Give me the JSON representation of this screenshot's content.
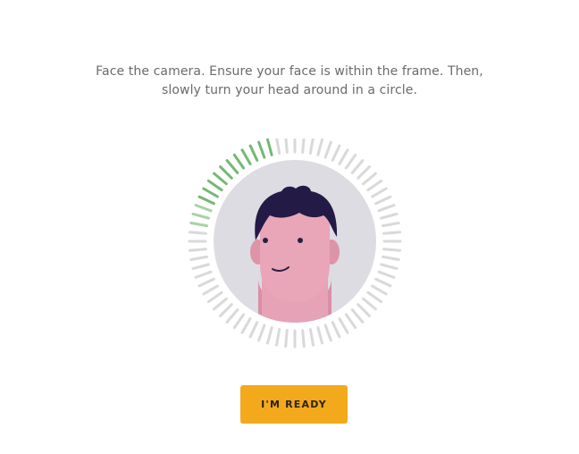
{
  "instructions": {
    "line1": "Face the camera. Ensure your face is within the frame. Then,",
    "line2": "slowly turn your head around in a circle."
  },
  "scan_progress": {
    "total_ticks": 72,
    "completed_start_angle_deg": 202,
    "completed_end_angle_deg": 258,
    "colors": {
      "inactive_tick": "#d9d9d9",
      "active_tick": "#74b874",
      "active_tick_fade": "#a7d3a7"
    }
  },
  "avatar": {
    "background": "#dcdce2",
    "skin": "#e8a6b8",
    "skin_shadow": "#d88ea3",
    "hair": "#231a45",
    "icon_name": "face-avatar-icon"
  },
  "button": {
    "label": "I'M READY",
    "color": "#f2a91c"
  }
}
